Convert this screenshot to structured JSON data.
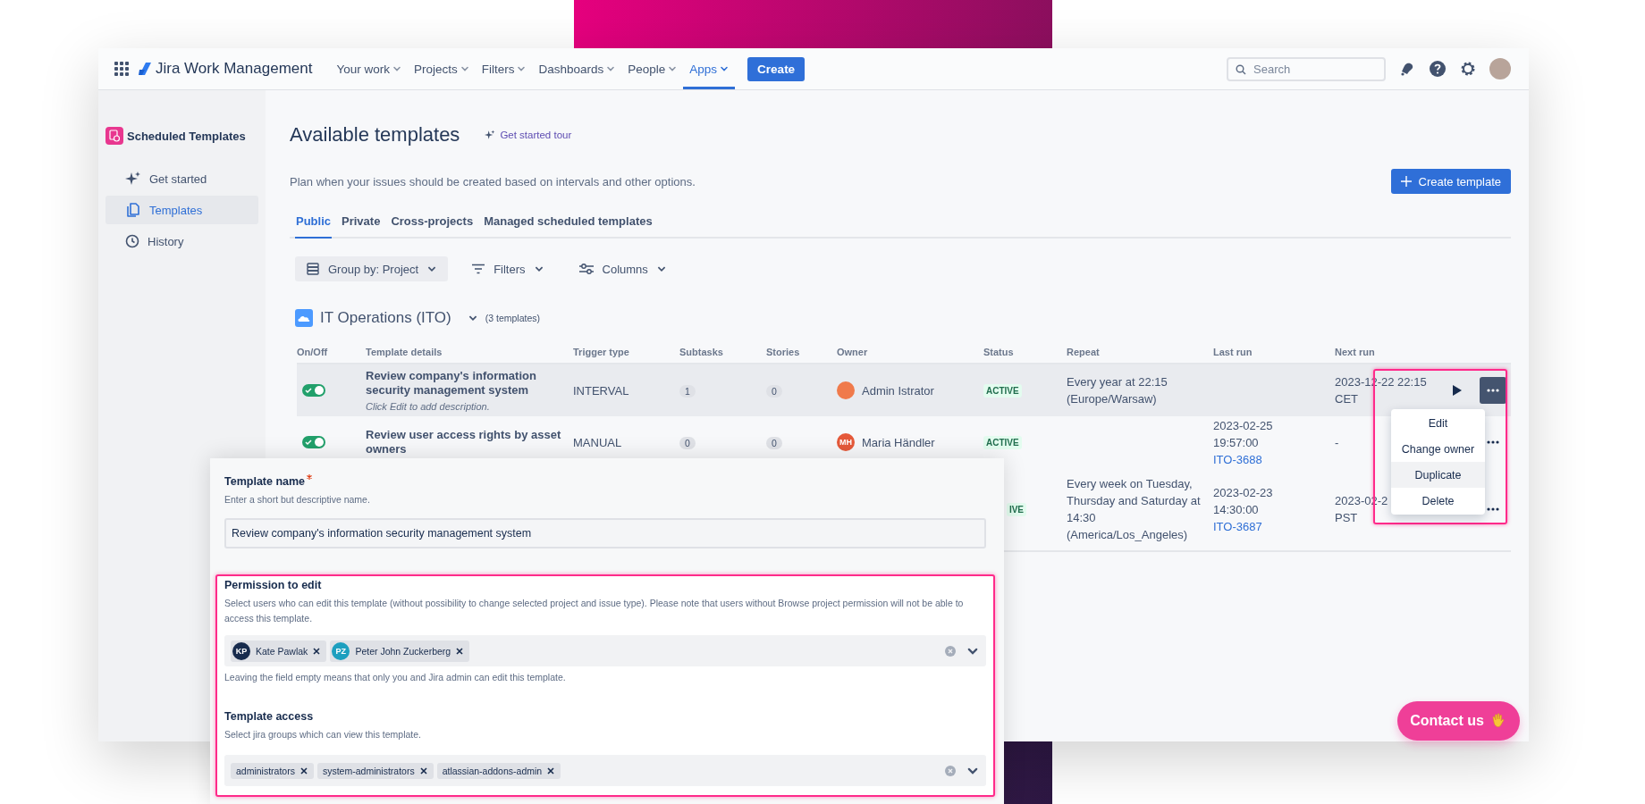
{
  "nav": {
    "product": "Jira Work Management",
    "menu": [
      {
        "label": "Your work",
        "selected": false
      },
      {
        "label": "Projects",
        "selected": false
      },
      {
        "label": "Filters",
        "selected": false
      },
      {
        "label": "Dashboards",
        "selected": false
      },
      {
        "label": "People",
        "selected": false
      },
      {
        "label": "Apps",
        "selected": true
      }
    ],
    "create": "Create",
    "search": {
      "placeholder": "Search"
    }
  },
  "sidebar": {
    "title": "Scheduled Templates",
    "items": [
      {
        "label": "Get started",
        "selected": false
      },
      {
        "label": "Templates",
        "selected": true
      },
      {
        "label": "History",
        "selected": false
      }
    ]
  },
  "page": {
    "title": "Available templates",
    "tour": "Get started tour",
    "description": "Plan when your issues should be created based on intervals and other options.",
    "create_button": "Create template",
    "tabs": [
      {
        "label": "Public",
        "selected": true
      },
      {
        "label": "Private",
        "selected": false
      },
      {
        "label": "Cross-projects",
        "selected": false
      },
      {
        "label": "Managed scheduled templates",
        "selected": false
      }
    ],
    "toolbar": [
      {
        "label": "Group by: Project",
        "kind": "filled"
      },
      {
        "label": "Filters",
        "kind": "plain"
      },
      {
        "label": "Columns",
        "kind": "plain"
      }
    ]
  },
  "group": {
    "name": "IT Operations (ITO)",
    "count": "(3 templates)",
    "expanded": true
  },
  "table": {
    "columns": [
      "On/Off",
      "Template details",
      "Trigger type",
      "Subtasks",
      "Stories",
      "Owner",
      "Status",
      "Repeat",
      "Last run",
      "Next run"
    ],
    "rows": [
      {
        "highlighted": true,
        "enabled": true,
        "title": "Review company's information security management system",
        "description": "Click Edit to add description.",
        "trigger": "INTERVAL",
        "subtasks": "1",
        "stories": "0",
        "owner": {
          "name": "Admin Istrator",
          "color": "#f07a4b"
        },
        "status": "ACTIVE",
        "status_clipped": false,
        "repeat": "Every year at 22:15 (Europe/Warsaw)",
        "next_run": {
          "time": "2023-12-22 22:15",
          "zone": "CET"
        },
        "run_button": true,
        "menu_open": true
      },
      {
        "highlighted": false,
        "enabled": true,
        "title": "Review user access rights by asset owners",
        "trigger": "MANUAL",
        "subtasks": "0",
        "stories": "0",
        "owner": {
          "name": "Maria Händler",
          "initials": "MH",
          "color": "#e5593a"
        },
        "status": "ACTIVE",
        "status_clipped": false,
        "last_run": {
          "time": "2023-02-25 19:57:00",
          "issue": "ITO-3688"
        },
        "next_run": {
          "time": "-"
        },
        "run_button": false,
        "menu_open": false
      },
      {
        "highlighted": false,
        "status": "IVE",
        "status_clipped": true,
        "repeat": "Every week on Tuesday, Thursday and Saturday at 14:30 (America/Los_Angeles)",
        "last_run": {
          "time": "2023-02-23 14:30:00",
          "issue": "ITO-3687"
        },
        "next_run": {
          "time": "2023-02-2",
          "zone": "PST"
        },
        "run_button": false,
        "menu_open": false
      }
    ]
  },
  "row_menu": {
    "items": [
      {
        "label": "Edit",
        "selected": false
      },
      {
        "label": "Change owner",
        "selected": false
      },
      {
        "label": "Duplicate",
        "selected": true
      },
      {
        "label": "Delete",
        "selected": false
      }
    ]
  },
  "form": {
    "name_field": {
      "label": "Template name",
      "required": true,
      "hint": "Enter a short but descriptive name.",
      "value": "Review company's information security management system"
    },
    "permission": {
      "label": "Permission to edit",
      "hint": "Select users who can edit this template (without possibility to change selected project and issue type). Please note that users without Browse project permission will not be able to access this template.",
      "users": [
        {
          "initials": "KP",
          "name": "Kate Pawlak",
          "color": "#172b4d"
        },
        {
          "initials": "PZ",
          "name": "Peter John Zuckerberg",
          "color": "#1d9fbf"
        }
      ],
      "note": "Leaving the field empty means that only you and Jira admin can edit this template."
    },
    "access": {
      "label": "Template access",
      "hint": "Select jira groups which can view this template.",
      "groups": [
        "administrators",
        "system-administrators",
        "atlassian-addons-admin"
      ]
    }
  },
  "contact_button": "Contact us"
}
